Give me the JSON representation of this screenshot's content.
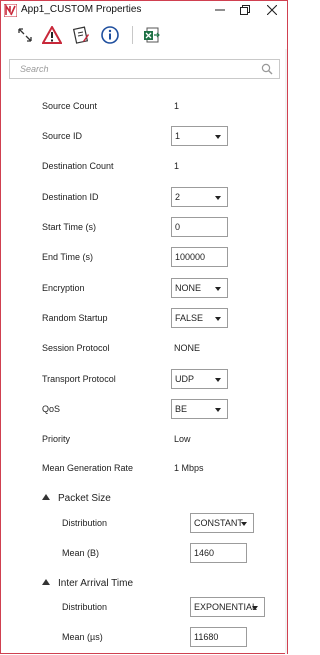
{
  "window": {
    "title": "App1_CUSTOM Properties",
    "accent_color": "#d04050",
    "controls": {
      "minimize_icon": "minimize-icon",
      "restore_icon": "restore-icon",
      "close_icon": "close-icon"
    }
  },
  "toolbar": {
    "icons": [
      "expand-arrows-icon",
      "warning-icon",
      "edit-document-icon",
      "info-icon",
      "export-excel-icon"
    ]
  },
  "search": {
    "placeholder": "Search"
  },
  "properties": {
    "source_count": {
      "label": "Source Count",
      "value": "1"
    },
    "source_id": {
      "label": "Source ID",
      "value": "1"
    },
    "destination_count": {
      "label": "Destination Count",
      "value": "1"
    },
    "destination_id": {
      "label": "Destination ID",
      "value": "2"
    },
    "start_time": {
      "label": "Start Time (s)",
      "value": "0"
    },
    "end_time": {
      "label": "End Time (s)",
      "value": "100000"
    },
    "encryption": {
      "label": "Encryption",
      "value": "NONE"
    },
    "random_startup": {
      "label": "Random Startup",
      "value": "FALSE"
    },
    "session_protocol": {
      "label": "Session Protocol",
      "value": "NONE"
    },
    "transport_protocol": {
      "label": "Transport Protocol",
      "value": "UDP"
    },
    "qos": {
      "label": "QoS",
      "value": "BE"
    },
    "priority": {
      "label": "Priority",
      "value": "Low"
    },
    "mean_generation_rate": {
      "label": "Mean Generation Rate",
      "value": "1 Mbps"
    }
  },
  "packet_size": {
    "title": "Packet Size",
    "distribution": {
      "label": "Distribution",
      "value": "CONSTANT"
    },
    "mean": {
      "label": "Mean (B)",
      "value": "1460"
    }
  },
  "inter_arrival_time": {
    "title": "Inter Arrival Time",
    "distribution": {
      "label": "Distribution",
      "value": "EXPONENTIAL"
    },
    "mean": {
      "label": "Mean (µs)",
      "value": "11680"
    }
  }
}
